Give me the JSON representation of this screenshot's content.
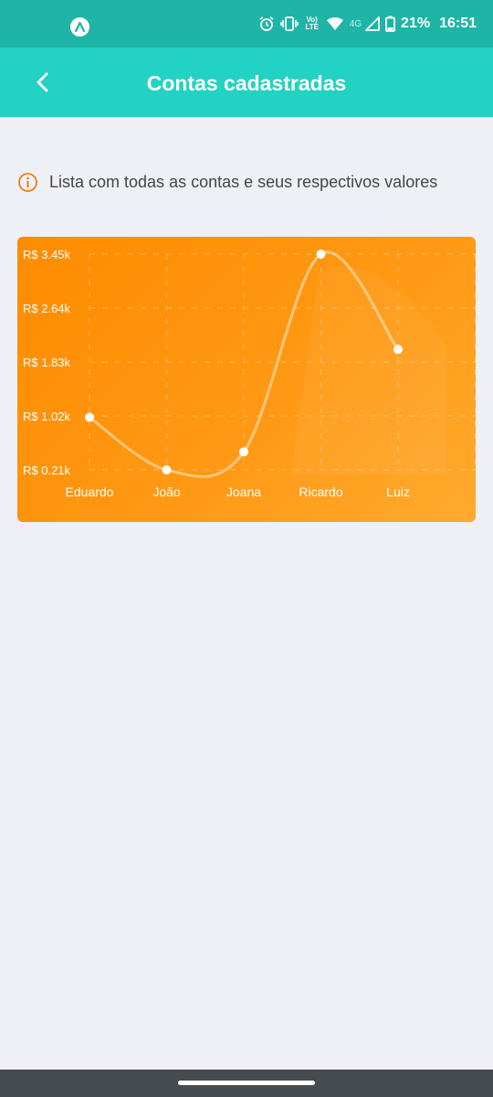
{
  "status_bar": {
    "volte": "Vo) LTE",
    "network": "4G",
    "battery": "21%",
    "time": "16:51",
    "icons": [
      "app-a-icon",
      "alarm-icon",
      "vibrate-icon",
      "volte-icon",
      "wifi-icon",
      "signal-icon",
      "battery-icon"
    ]
  },
  "app_bar": {
    "title": "Contas cadastradas",
    "back_icon": "chevron-left-icon"
  },
  "info": {
    "text": "Lista com todas as contas e seus respectivos valores",
    "icon": "info-icon",
    "color": "#f07c10"
  },
  "chart_data": {
    "type": "line",
    "categories": [
      "Eduardo",
      "João",
      "Joana",
      "Ricardo",
      "Luiz"
    ],
    "values": [
      1000,
      210,
      480,
      3450,
      2020
    ],
    "y_ticks": [
      "R$ 3.45k",
      "R$ 2.64k",
      "R$ 1.83k",
      "R$ 1.02k",
      "R$ 0.21k"
    ],
    "y_tick_values": [
      3450,
      2640,
      1830,
      1020,
      210
    ],
    "ylim": [
      210,
      3450
    ],
    "grid": true,
    "smooth": true
  },
  "colors": {
    "status_bar": "#1fb5a6",
    "app_bar": "#22d2c3",
    "chart_bg": "#fd8c00",
    "page_bg": "#eff0f5"
  }
}
